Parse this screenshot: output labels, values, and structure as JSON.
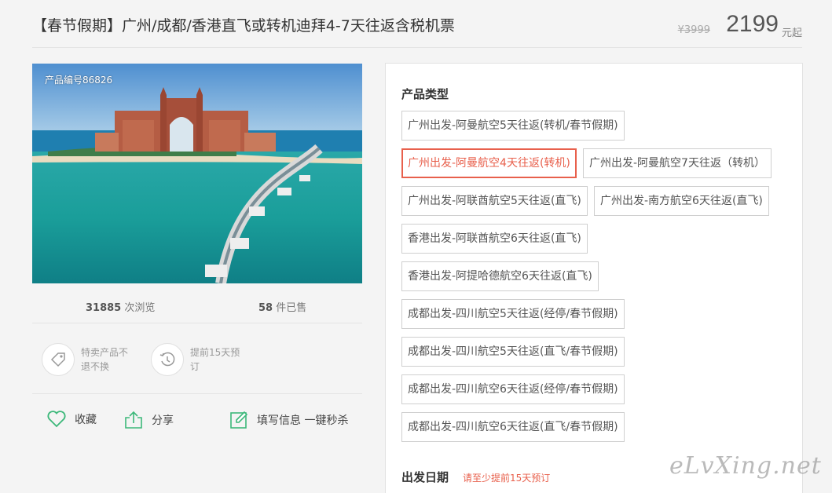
{
  "header": {
    "title": "【春节假期】广州/成都/香港直飞或转机迪拜4-7天往返含税机票",
    "old_price": "¥3999",
    "price": "2199",
    "price_unit": "元起"
  },
  "hero": {
    "product_id": "产品编号86826"
  },
  "stats": {
    "views_count": "31885",
    "views_label": "次浏览",
    "sold_count": "58",
    "sold_label": "件已售"
  },
  "badges": [
    {
      "icon": "tag-icon",
      "text": "特卖产品不退不换"
    },
    {
      "icon": "clock-history-icon",
      "text": "提前15天预订"
    }
  ],
  "actions": {
    "favorite": "收藏",
    "share": "分享",
    "fill_info": "填写信息 一键秒杀"
  },
  "panel": {
    "product_type_label": "产品类型",
    "options": [
      "广州出发-阿曼航空5天往返(转机/春节假期)",
      "广州出发-阿曼航空4天往返(转机)",
      "广州出发-阿曼航空7天往返（转机）",
      "广州出发-阿联酋航空5天往返(直飞)",
      "广州出发-南方航空6天往返(直飞)",
      "香港出发-阿联酋航空6天往返(直飞)",
      "香港出发-阿提哈德航空6天往返(直飞)",
      "成都出发-四川航空5天往返(经停/春节假期)",
      "成都出发-四川航空5天往返(直飞/春节假期)",
      "成都出发-四川航空6天往返(经停/春节假期)",
      "成都出发-四川航空6天往返(直飞/春节假期)"
    ],
    "selected_index": 1,
    "date_label": "出发日期",
    "date_hint": "请至少提前15天预订"
  },
  "watermark": "eLvXing.net",
  "colors": {
    "accent": "#e8604c",
    "icon_green": "#3cb87a"
  }
}
